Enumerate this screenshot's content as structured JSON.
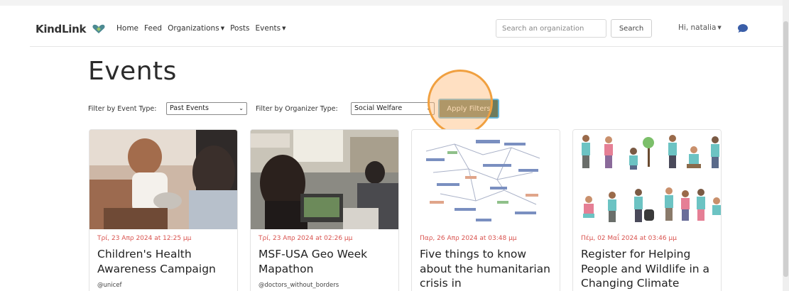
{
  "navbar": {
    "brand": "KindLink",
    "links": [
      "Home",
      "Feed",
      "Organizations",
      "Posts",
      "Events"
    ],
    "search_placeholder": "Search an organization",
    "search_button": "Search",
    "user_menu": "Hi, natalia"
  },
  "page": {
    "title": "Events"
  },
  "filters": {
    "event_type_label": "Filter by Event Type:",
    "event_type_value": "Past Events",
    "organizer_type_label": "Filter by Organizer Type:",
    "organizer_type_value": "Social Welfare",
    "apply_button": "Apply Filters"
  },
  "events": [
    {
      "date": "Τρί, 23 Απρ 2024 at 12:25 μμ",
      "title": "Children's Health Awareness Campaign",
      "organizer": "@unicef"
    },
    {
      "date": "Τρί, 23 Απρ 2024 at 02:26 μμ",
      "title": "MSF-USA Geo Week Mapathon",
      "organizer": "@doctors_without_borders"
    },
    {
      "date": "Παρ, 26 Απρ 2024 at 03:48 μμ",
      "title": "Five things to know about the humanitarian crisis in",
      "organizer": ""
    },
    {
      "date": "Πέμ, 02 Μαΐ 2024 at 03:46 μμ",
      "title": "Register for Helping People and Wildlife in a Changing Climate",
      "organizer": ""
    }
  ],
  "colors": {
    "date_red": "#d9534f",
    "apply_button_bg": "#6e7b5c",
    "apply_button_border": "#67b6d8",
    "brand_heart": "#4c8a92",
    "chat_icon": "#3a5ea8",
    "click_highlight": "#f0a040"
  },
  "icons": {
    "brand": "heart-hands-icon",
    "chat": "chat-bubble-icon"
  }
}
